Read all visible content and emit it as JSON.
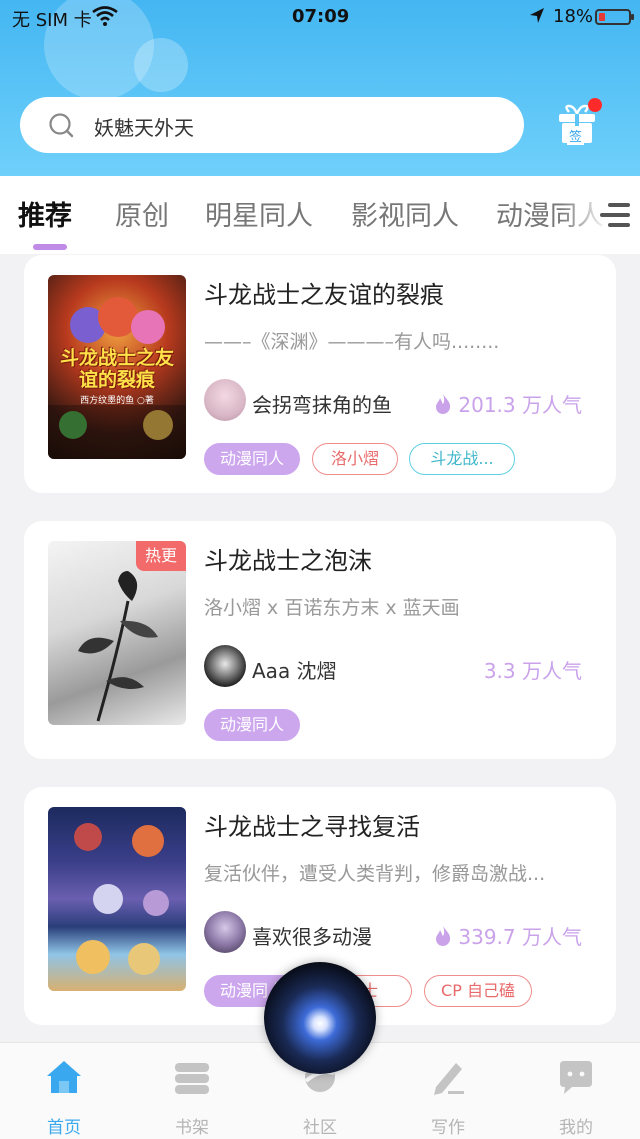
{
  "status_bar": {
    "carrier": "无 SIM 卡",
    "time": "07:09",
    "battery": "18%"
  },
  "search": {
    "placeholder": "妖魅天外天"
  },
  "sign_in": {
    "label": "签"
  },
  "tabs": [
    {
      "label": "推荐",
      "active": true
    },
    {
      "label": "原创"
    },
    {
      "label": "明星同人"
    },
    {
      "label": "影视同人"
    },
    {
      "label": "动漫同人"
    }
  ],
  "books": [
    {
      "title": "斗龙战士之友谊的裂痕",
      "description": "——–《深渊》———–有人吗........",
      "author": "会拐弯抹角的鱼",
      "popularity": "201.3 万人气",
      "badge": "",
      "tags": [
        "动漫同人",
        "洛小熠",
        "斗龙战..."
      ],
      "cover_text": "斗龙战士之友谊的裂痕",
      "cover_subtext": "西方纹墨的鱼 ○著"
    },
    {
      "title": "斗龙战士之泡沫",
      "description": "洛小熠 x 百诺东方末 x 蓝天画",
      "author": "Aaa 沈熠",
      "popularity": "3.3 万人气",
      "badge": "热更",
      "tags": [
        "动漫同人"
      ]
    },
    {
      "title": "斗龙战士之寻找复活",
      "description": "复活伙伴，遭受人类背判，修爵岛激战...",
      "author": "喜欢很多动漫",
      "popularity": "339.7 万人气",
      "badge": "",
      "tags": [
        "动漫同人",
        "战士",
        "CP 自己磕"
      ]
    }
  ],
  "bottom_nav": [
    {
      "label": "首页",
      "icon": "home-icon",
      "active": true
    },
    {
      "label": "书架",
      "icon": "bookshelf-icon"
    },
    {
      "label": "社区",
      "icon": "community-icon"
    },
    {
      "label": "写作",
      "icon": "write-icon"
    },
    {
      "label": "我的",
      "icon": "profile-icon"
    }
  ],
  "colors": {
    "header_blue": "#44b6f2",
    "accent_purple": "#c08be6",
    "popularity_purple": "#c9a2ea",
    "nav_active": "#3aa8ee",
    "hot_badge": "#f26a6a"
  }
}
